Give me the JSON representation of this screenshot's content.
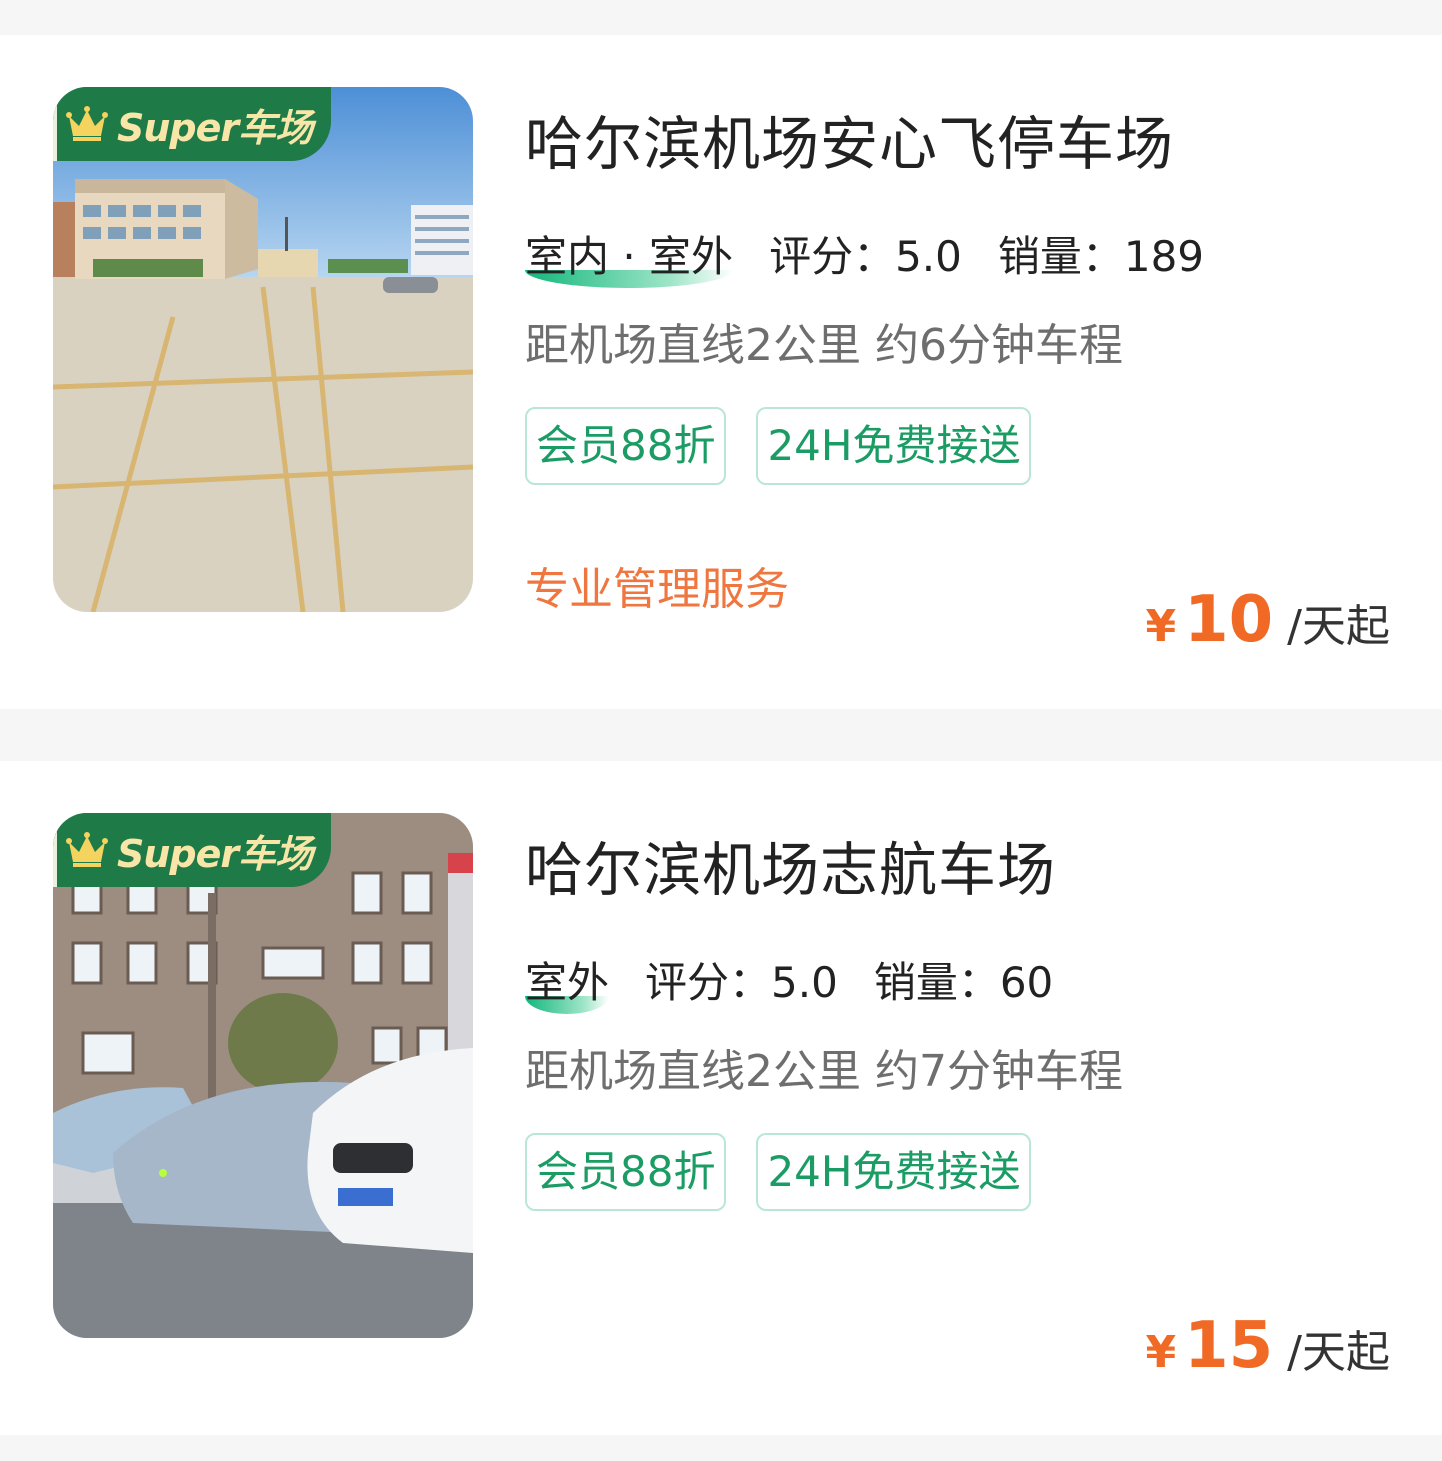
{
  "listings": [
    {
      "badge": "Super车场",
      "name": "哈尔滨机场安心飞停车场",
      "types": "室内 · 室外",
      "rating": "评分：5.0",
      "sales": "销量：189",
      "distance": "距机场直线2公里 约6分钟车程",
      "tags": [
        "会员88折",
        "24H免费接送"
      ],
      "service": "专业管理服务",
      "price_currency": "¥",
      "price": "10",
      "price_unit": "/天起"
    },
    {
      "badge": "Super车场",
      "name": "哈尔滨机场志航车场",
      "types": "室外",
      "rating": "评分：5.0",
      "sales": "销量：60",
      "distance": "距机场直线2公里 约7分钟车程",
      "tags": [
        "会员88折",
        "24H免费接送"
      ],
      "service": "",
      "price_currency": "¥",
      "price": "15",
      "price_unit": "/天起"
    }
  ],
  "colors": {
    "accent_green": "#1a9c64",
    "badge_green": "#1e7a46",
    "price_orange": "#f06a25",
    "service_orange": "#f0763f"
  },
  "icons": {
    "badge_icon": "crown-icon"
  }
}
